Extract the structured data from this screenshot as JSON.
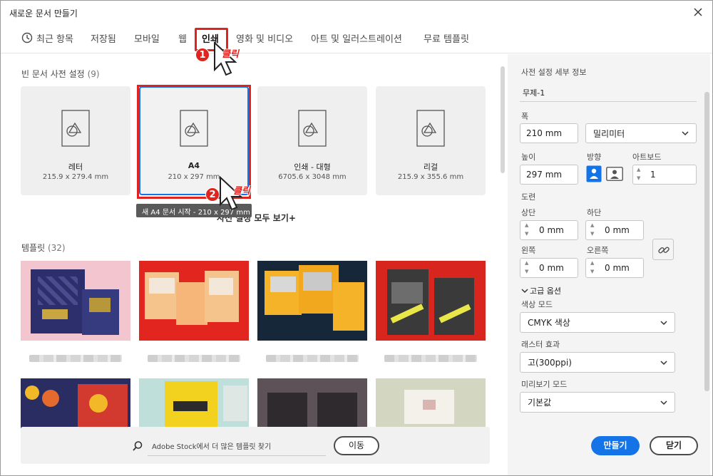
{
  "window": {
    "title": "새로운 문서 만들기"
  },
  "tabs": [
    {
      "label": "최근 항목"
    },
    {
      "label": "저장됨"
    },
    {
      "label": "모바일"
    },
    {
      "label": "웹"
    },
    {
      "label": "인쇄"
    },
    {
      "label": "영화 및 비디오"
    },
    {
      "label": "아트 및 일러스트레이션"
    },
    {
      "label": "무료 템플릿"
    }
  ],
  "blank_presets": {
    "title": "빈 문서 사전 설정",
    "count": "(9)",
    "items": [
      {
        "name": "레터",
        "size": "215.9 x 279.4 mm"
      },
      {
        "name": "A4",
        "size": "210 x 297 mm"
      },
      {
        "name": "인쇄 - 대형",
        "size": "6705.6 x 3048 mm"
      },
      {
        "name": "리걸",
        "size": "215.9 x 355.6 mm"
      }
    ],
    "tooltip": "새 A4 문서 시작 - 210 x 297 mm",
    "view_all": "사전 설정 모두 보기+"
  },
  "templates": {
    "title": "템플릿",
    "count": "(32)"
  },
  "stock": {
    "text": "Adobe Stock에서 더 많은 템플릿 찾기",
    "go_label": "이동"
  },
  "details": {
    "title": "사전 설정 세부 정보",
    "doc_name": "무제-1",
    "width_label": "폭",
    "width_value": "210 mm",
    "unit_value": "밀리미터",
    "height_label": "높이",
    "height_value": "297 mm",
    "orientation_label": "방향",
    "artboard_label": "아트보드",
    "artboard_value": "1",
    "bleed_label": "도련",
    "top_label": "상단",
    "top_value": "0 mm",
    "bottom_label": "하단",
    "bottom_value": "0 mm",
    "left_label": "왼쪽",
    "left_value": "0 mm",
    "right_label": "오른쪽",
    "right_value": "0 mm",
    "advanced_label": "고급 옵션",
    "color_mode_label": "색상 모드",
    "color_mode_value": "CMYK 색상",
    "raster_label": "래스터 효과",
    "raster_value": "고(300ppi)",
    "preview_label": "미리보기 모드",
    "preview_value": "기본값",
    "create_label": "만들기",
    "close_label": "닫기"
  },
  "annotations": {
    "step1": "1",
    "step2": "2",
    "click": "클릭"
  },
  "colors": {
    "accent": "#1473e6",
    "annotation": "#e0231f"
  }
}
